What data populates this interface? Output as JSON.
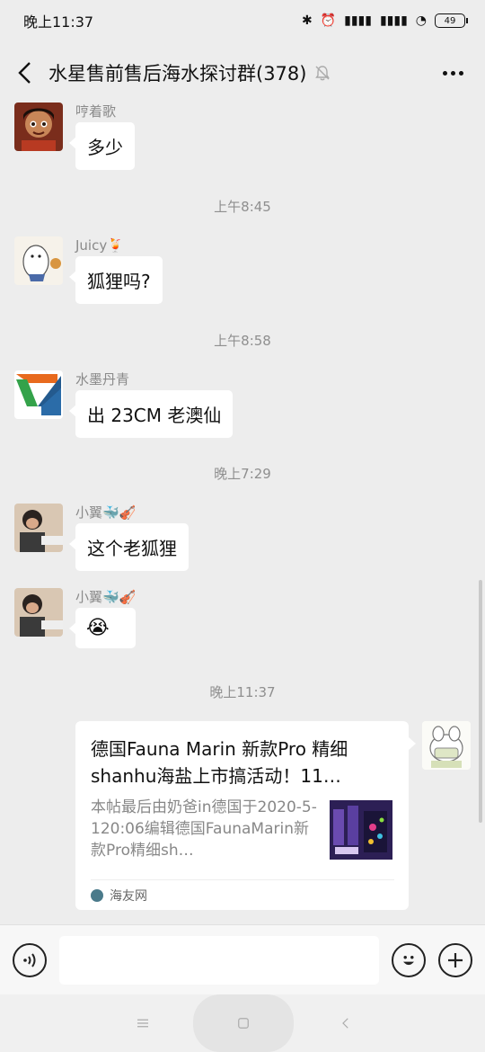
{
  "status": {
    "time": "晚上11:37",
    "battery": "49"
  },
  "header": {
    "title": "水星售前售后海水探讨群(378)"
  },
  "messages": [
    {
      "sender": "哼着歌",
      "text": "多少"
    },
    {
      "timestamp": "上午8:45"
    },
    {
      "sender": "Juicy🍹",
      "text": "狐狸吗?"
    },
    {
      "timestamp": "上午8:58"
    },
    {
      "sender": "水墨丹青",
      "text": "出 23CM 老澳仙"
    },
    {
      "timestamp": "晚上7:29"
    },
    {
      "sender": "小翼🐳🎻",
      "text": "这个老狐狸"
    },
    {
      "sender": "小翼🐳🎻",
      "text": "😭"
    },
    {
      "timestamp": "晚上11:37"
    }
  ],
  "card": {
    "title": "德国Fauna Marin 新款Pro 精细shanhu海盐上市搞活动！11…",
    "desc": "本帖最后由奶爸in德国于2020-5-120:06编辑德国FaunaMarin新款Pro精细sh…",
    "source": "海友网"
  },
  "colors": {
    "background": "#ededed",
    "bubble": "#ffffff",
    "accent": "#111111"
  }
}
